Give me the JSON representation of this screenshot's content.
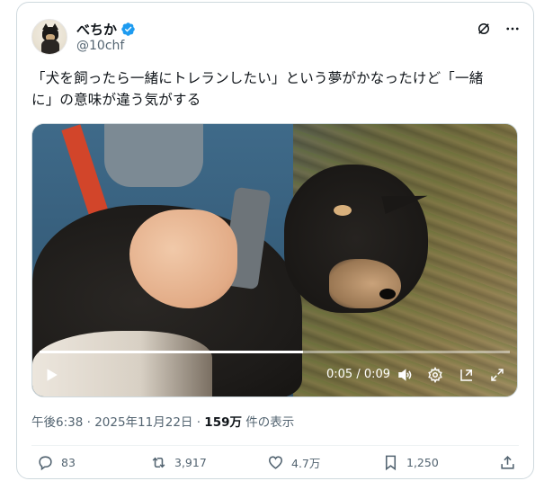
{
  "author": {
    "display_name": "べちか",
    "handle": "@10chf",
    "verified": true
  },
  "header_icons": [
    "grok-icon",
    "more-icon"
  ],
  "tweet": {
    "text_line1": "「犬を飼ったら一緒にトレランしたい」という夢がかなったけど「一緒",
    "text_line2": "に」の意味が違う気がする"
  },
  "video": {
    "time": "0:05 / 0:09",
    "progress": 0.56
  },
  "meta": {
    "time": "午後6:38",
    "sep1": " · ",
    "date": "2025年11月22日",
    "sep2": " · ",
    "views_count": "159万",
    "views_label": " 件の表示"
  },
  "actions": {
    "replies": "83",
    "reposts": "3,917",
    "likes": "4.7万",
    "bookmarks": "1,250"
  },
  "colors": {
    "verified_blue": "#1d9bf0",
    "secondary_text": "#536471"
  }
}
